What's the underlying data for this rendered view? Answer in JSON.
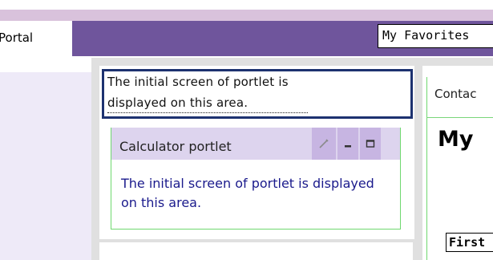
{
  "header": {
    "portal_tab_label": "Portal",
    "favorites_label": "My Favorites"
  },
  "info_box": {
    "line1": "The initial screen of portlet is",
    "line2": "displayed on this area."
  },
  "portlet": {
    "title": "Calculator portlet",
    "body": "The initial screen of portlet is displayed on this area.",
    "icons": [
      "pencil-icon",
      "minimize-icon",
      "maximize-icon"
    ]
  },
  "right_column": {
    "contact_label": "Contac",
    "title": "My",
    "first_field_label": "First"
  },
  "colors": {
    "navbar": "#6f559c",
    "header_light": "#d9c2dc",
    "info_border": "#1d3270",
    "portlet_border": "#6fd86f",
    "portlet_text": "#1a1a8c"
  }
}
